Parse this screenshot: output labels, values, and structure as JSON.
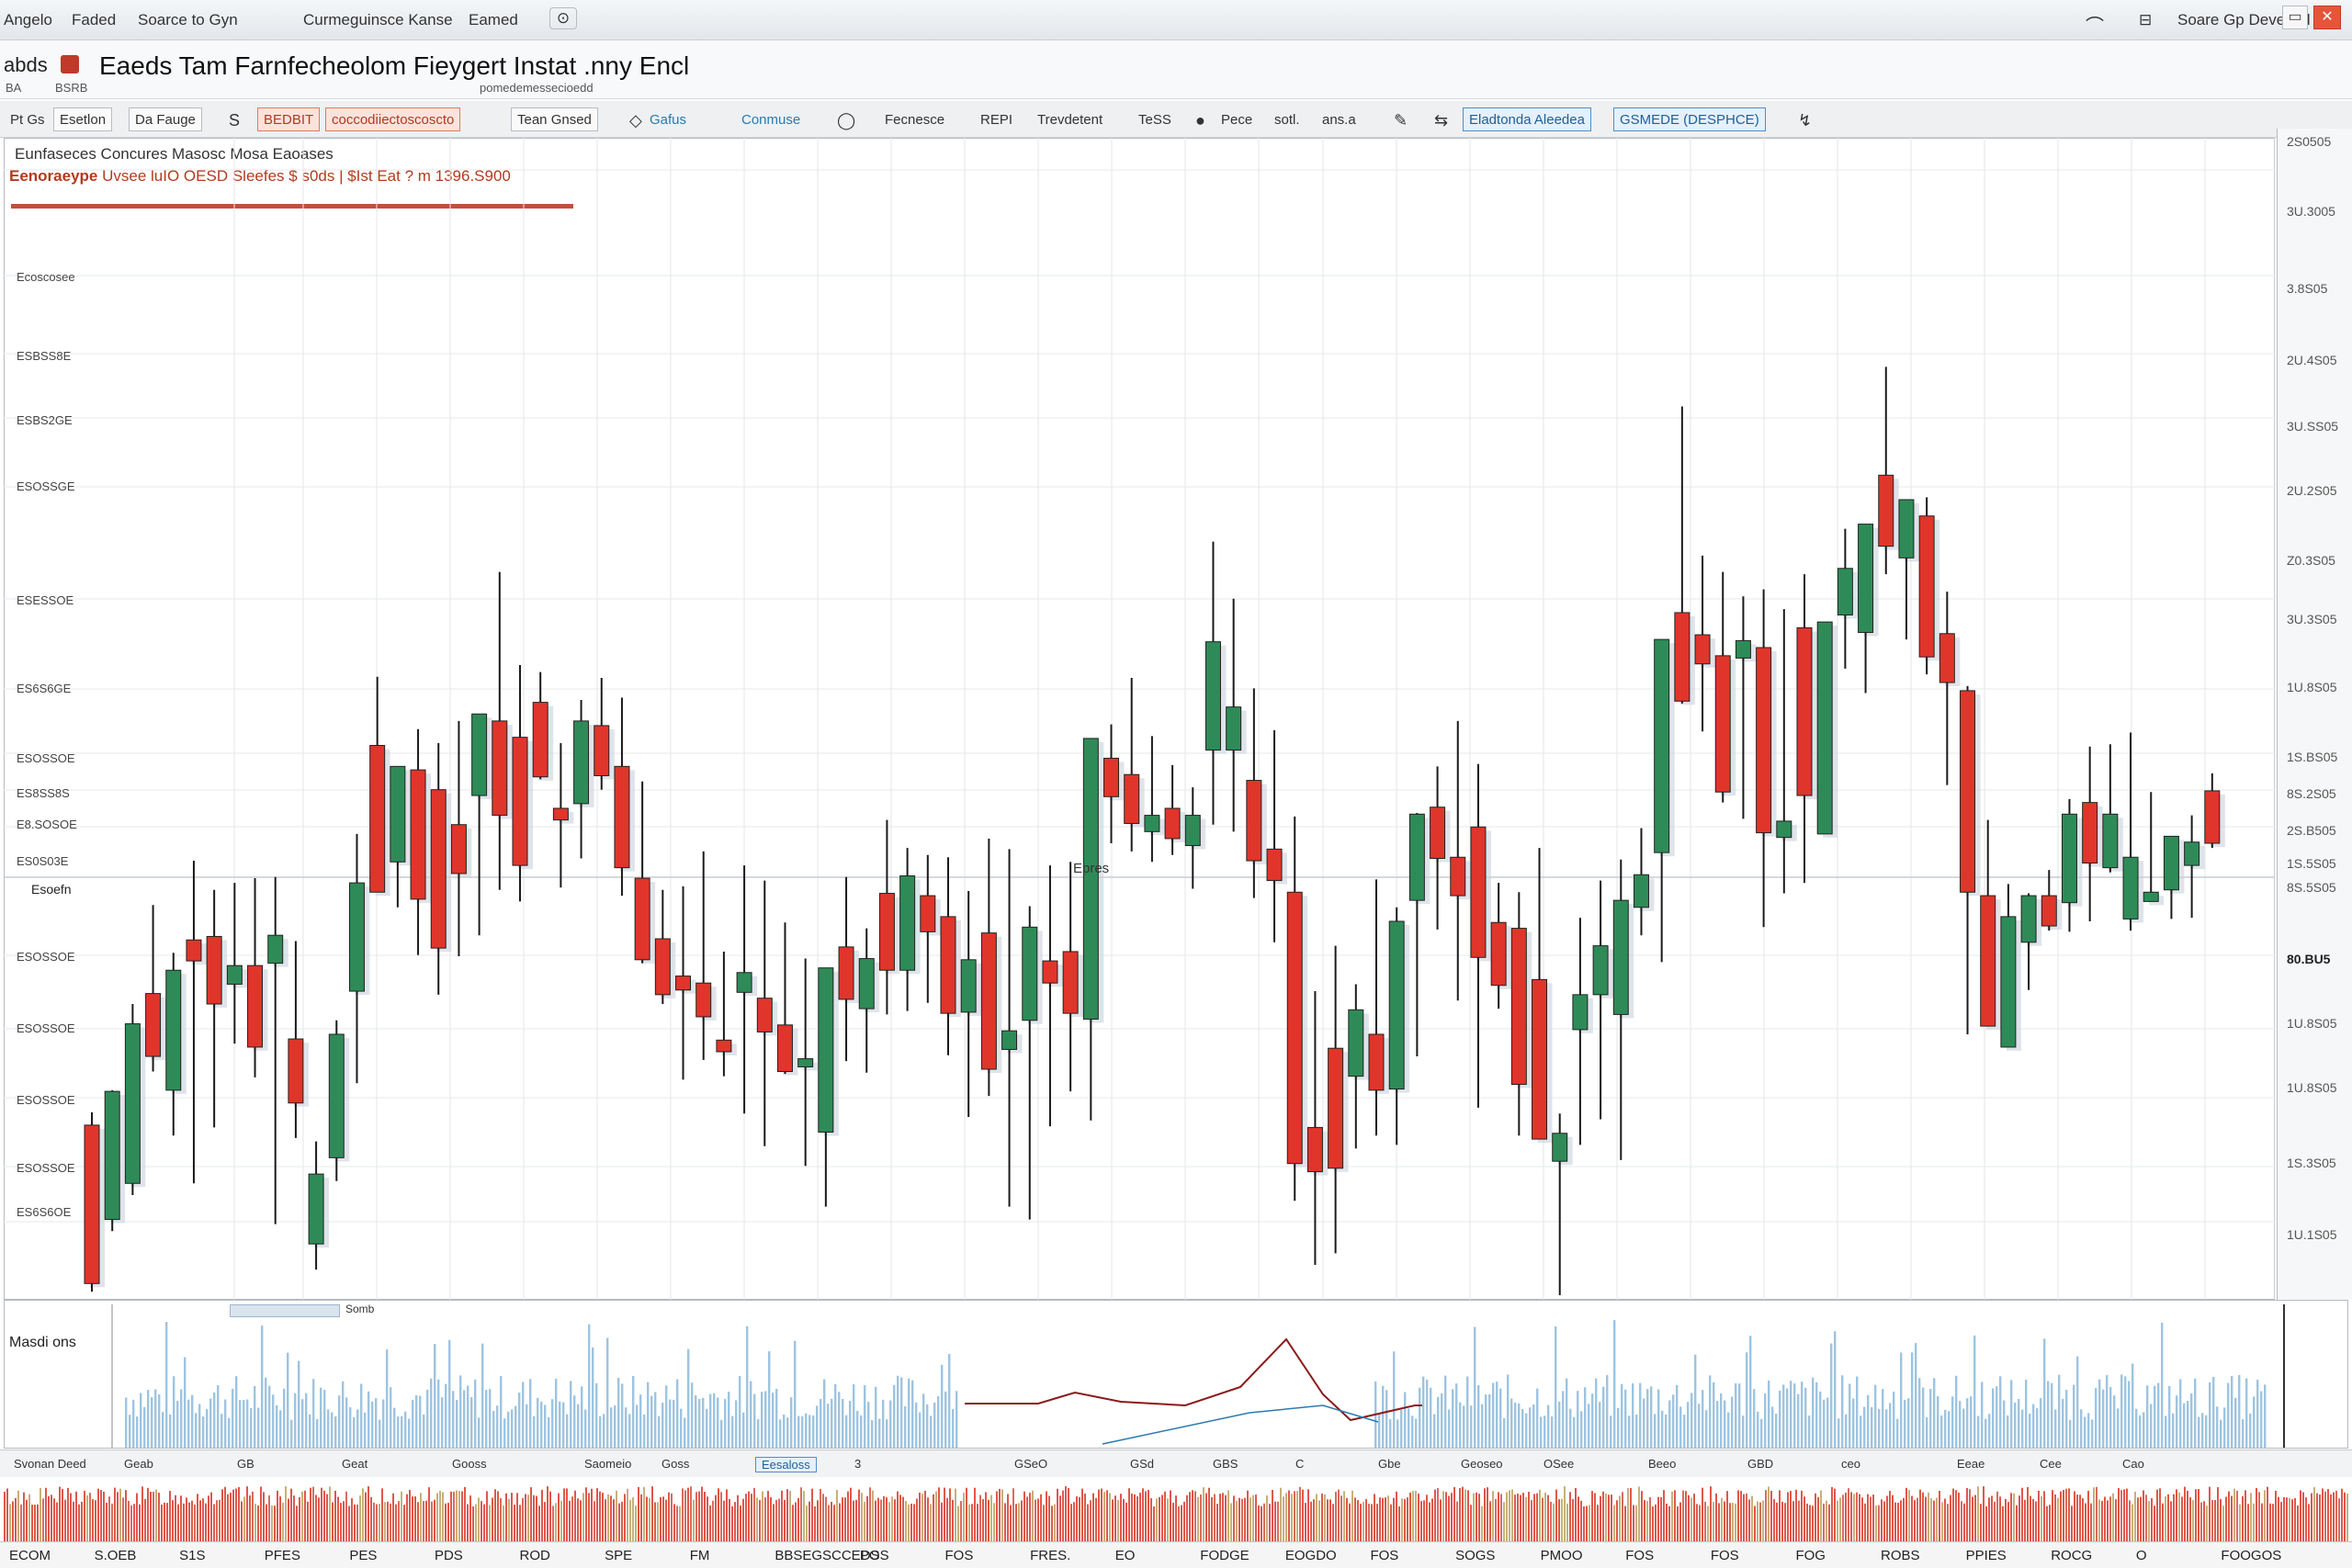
{
  "window": {
    "title_items": [
      "Angelo",
      "Faded",
      "Soarce to Gyn",
      "Curmeguinsce Kanse",
      "Eamed"
    ],
    "right_text": "Soare Gp Deveced",
    "buttons": [
      "▭",
      "—",
      "✕"
    ]
  },
  "menubar": {
    "app": "abds",
    "title": "Eaeds Tam Farnfecheolom Fieygert Instat .nny Encl",
    "sub_left": "BA",
    "sub_mid": "BSRB",
    "sub_right": "pomedemessecioedd"
  },
  "toolbar": {
    "items": [
      {
        "label": "Pt Gs",
        "style": ""
      },
      {
        "label": "Esetlon",
        "style": "boxed"
      },
      {
        "label": "Da Fauge",
        "style": "boxed"
      },
      {
        "label": "S",
        "style": "icon"
      },
      {
        "label": "BEDBIT",
        "style": "red"
      },
      {
        "label": "coccodiiectoscoscto",
        "style": "red"
      },
      {
        "label": "Tean Gnsed",
        "style": "boxed"
      },
      {
        "label": "Gafus",
        "style": "blue"
      },
      {
        "label": "Conmuse",
        "style": "blue"
      },
      {
        "label": "Fecnesce",
        "style": ""
      },
      {
        "label": "REPI",
        "style": ""
      },
      {
        "label": "Trevdetent",
        "style": ""
      },
      {
        "label": "TeSS",
        "style": ""
      },
      {
        "label": "Pece",
        "style": ""
      },
      {
        "label": "sotl.",
        "style": ""
      },
      {
        "label": "ans.a",
        "style": ""
      },
      {
        "label": "Eladtonda Aleedea",
        "style": "bluebox"
      },
      {
        "label": "GSMEDE (DESPHCE)",
        "style": "bluebox"
      }
    ]
  },
  "info": {
    "line1": "Eunfaseces Concures   Masosc Mosa Eaoases",
    "line2_prefix": "Eenoraeype",
    "line2_rest": "Uvsee luIO OESD Sleefes  $ s0ds  |  $Ist Eat ?  m  1396.S900"
  },
  "chart_data": {
    "type": "candlestick",
    "colors": {
      "up": "#2e8b57",
      "down": "#e0352b",
      "accent": "#c0392b"
    },
    "price_range": [
      0,
      100
    ],
    "grid": true,
    "candles": [
      {
        "o": 14.6,
        "h": 15.7,
        "l": 0.3,
        "c": 1.0
      },
      {
        "o": 6.5,
        "h": 17.6,
        "l": 5.5,
        "c": 17.5
      },
      {
        "o": 9.6,
        "h": 25.0,
        "l": 8.6,
        "c": 23.3
      },
      {
        "o": 25.9,
        "h": 33.5,
        "l": 19.2,
        "c": 20.5
      },
      {
        "o": 17.6,
        "h": 29.4,
        "l": 13.7,
        "c": 27.9
      },
      {
        "o": 30.5,
        "h": 37.3,
        "l": 9.6,
        "c": 28.7
      },
      {
        "o": 30.8,
        "h": 34.8,
        "l": 14.4,
        "c": 25.0
      },
      {
        "o": 26.7,
        "h": 35.4,
        "l": 21.6,
        "c": 28.3
      },
      {
        "o": 28.3,
        "h": 35.8,
        "l": 18.7,
        "c": 21.3
      },
      {
        "o": 28.5,
        "h": 35.9,
        "l": 6.1,
        "c": 30.9
      },
      {
        "o": 22.0,
        "h": 30.4,
        "l": 13.5,
        "c": 16.5
      },
      {
        "o": 4.4,
        "h": 13.2,
        "l": 2.2,
        "c": 10.4
      },
      {
        "o": 11.8,
        "h": 23.6,
        "l": 9.8,
        "c": 22.4
      },
      {
        "o": 26.1,
        "h": 39.6,
        "l": 18.2,
        "c": 35.4
      },
      {
        "o": 47.2,
        "h": 53.1,
        "l": 35.6,
        "c": 34.6
      },
      {
        "o": 37.2,
        "h": 43.9,
        "l": 33.3,
        "c": 45.4
      },
      {
        "o": 45.1,
        "h": 48.6,
        "l": 29.2,
        "c": 34.0
      },
      {
        "o": 43.4,
        "h": 47.4,
        "l": 25.8,
        "c": 29.8
      },
      {
        "o": 40.4,
        "h": 49.3,
        "l": 29.1,
        "c": 36.2
      },
      {
        "o": 42.9,
        "h": 49.3,
        "l": 30.9,
        "c": 49.9
      },
      {
        "o": 49.3,
        "h": 62.1,
        "l": 34.8,
        "c": 41.2
      },
      {
        "o": 47.9,
        "h": 54.1,
        "l": 33.8,
        "c": 36.9
      },
      {
        "o": 50.9,
        "h": 53.5,
        "l": 44.3,
        "c": 44.5
      },
      {
        "o": 41.8,
        "h": 47.4,
        "l": 35.0,
        "c": 40.8
      },
      {
        "o": 42.2,
        "h": 51.1,
        "l": 37.5,
        "c": 49.3
      },
      {
        "o": 48.9,
        "h": 53.0,
        "l": 43.4,
        "c": 44.6
      },
      {
        "o": 45.4,
        "h": 51.3,
        "l": 34.3,
        "c": 36.7
      },
      {
        "o": 35.8,
        "h": 44.1,
        "l": 28.5,
        "c": 28.8
      },
      {
        "o": 30.6,
        "h": 34.8,
        "l": 25.0,
        "c": 25.8
      },
      {
        "o": 27.4,
        "h": 35.1,
        "l": 18.5,
        "c": 26.2
      },
      {
        "o": 26.8,
        "h": 38.1,
        "l": 20.2,
        "c": 23.9
      },
      {
        "o": 21.9,
        "h": 29.5,
        "l": 18.8,
        "c": 20.9
      },
      {
        "o": 26.0,
        "h": 36.9,
        "l": 15.6,
        "c": 27.7
      },
      {
        "o": 25.5,
        "h": 35.6,
        "l": 12.8,
        "c": 22.6
      },
      {
        "o": 23.2,
        "h": 32.0,
        "l": 19.0,
        "c": 19.2
      },
      {
        "o": 19.6,
        "h": 28.9,
        "l": 11.1,
        "c": 20.3
      },
      {
        "o": 14.0,
        "h": 26.5,
        "l": 7.6,
        "c": 28.1
      },
      {
        "o": 29.9,
        "h": 35.9,
        "l": 20.1,
        "c": 25.4
      },
      {
        "o": 24.6,
        "h": 31.5,
        "l": 19.1,
        "c": 28.9
      },
      {
        "o": 34.5,
        "h": 40.8,
        "l": 24.1,
        "c": 27.9
      },
      {
        "o": 27.9,
        "h": 38.4,
        "l": 24.4,
        "c": 36.0
      },
      {
        "o": 34.3,
        "h": 37.8,
        "l": 25.1,
        "c": 31.2
      },
      {
        "o": 32.5,
        "h": 37.6,
        "l": 20.6,
        "c": 24.2
      },
      {
        "o": 24.3,
        "h": 34.7,
        "l": 15.3,
        "c": 28.8
      },
      {
        "o": 31.1,
        "h": 39.2,
        "l": 17.1,
        "c": 19.4
      },
      {
        "o": 21.1,
        "h": 38.3,
        "l": 7.6,
        "c": 22.7
      },
      {
        "o": 23.6,
        "h": 33.4,
        "l": 6.5,
        "c": 31.6
      },
      {
        "o": 28.7,
        "h": 36.9,
        "l": 14.5,
        "c": 26.8
      },
      {
        "o": 29.5,
        "h": 37.2,
        "l": 17.5,
        "c": 24.2
      },
      {
        "o": 23.7,
        "h": 38.9,
        "l": 15.0,
        "c": 47.8
      },
      {
        "o": 46.1,
        "h": 49.0,
        "l": 38.8,
        "c": 42.8
      },
      {
        "o": 44.7,
        "h": 53.0,
        "l": 38.1,
        "c": 40.5
      },
      {
        "o": 39.8,
        "h": 48.0,
        "l": 37.2,
        "c": 41.2
      },
      {
        "o": 41.8,
        "h": 45.5,
        "l": 37.8,
        "c": 39.2
      },
      {
        "o": 38.6,
        "h": 43.6,
        "l": 34.9,
        "c": 41.2
      },
      {
        "o": 46.8,
        "h": 64.7,
        "l": 40.4,
        "c": 56.1
      },
      {
        "o": 46.8,
        "h": 59.8,
        "l": 39.8,
        "c": 50.5
      },
      {
        "o": 44.2,
        "h": 52.1,
        "l": 34.1,
        "c": 37.3
      },
      {
        "o": 38.3,
        "h": 48.5,
        "l": 30.3,
        "c": 35.6
      },
      {
        "o": 34.6,
        "h": 41.1,
        "l": 8.1,
        "c": 11.3
      },
      {
        "o": 14.4,
        "h": 26.1,
        "l": 2.6,
        "c": 10.6
      },
      {
        "o": 21.2,
        "h": 30.0,
        "l": 3.6,
        "c": 10.9
      },
      {
        "o": 18.8,
        "h": 26.7,
        "l": 12.6,
        "c": 24.5
      },
      {
        "o": 22.4,
        "h": 35.7,
        "l": 13.7,
        "c": 17.6
      },
      {
        "o": 17.7,
        "h": 33.3,
        "l": 12.9,
        "c": 32.1
      },
      {
        "o": 33.9,
        "h": 41.4,
        "l": 20.5,
        "c": 41.3
      },
      {
        "o": 41.9,
        "h": 45.4,
        "l": 31.4,
        "c": 37.5
      },
      {
        "o": 37.6,
        "h": 49.3,
        "l": 25.3,
        "c": 34.3
      },
      {
        "o": 40.2,
        "h": 45.6,
        "l": 16.1,
        "c": 29.0
      },
      {
        "o": 32.0,
        "h": 35.4,
        "l": 24.6,
        "c": 26.6
      },
      {
        "o": 31.5,
        "h": 34.6,
        "l": 13.7,
        "c": 18.1
      },
      {
        "o": 27.1,
        "h": 38.4,
        "l": 17.2,
        "c": 13.4
      },
      {
        "o": 11.5,
        "h": 15.6,
        "l": 0.0,
        "c": 13.9
      },
      {
        "o": 22.8,
        "h": 32.4,
        "l": 12.9,
        "c": 25.8
      },
      {
        "o": 25.8,
        "h": 35.6,
        "l": 15.1,
        "c": 30.0
      },
      {
        "o": 24.1,
        "h": 37.4,
        "l": 11.6,
        "c": 33.9
      },
      {
        "o": 33.3,
        "h": 40.1,
        "l": 30.9,
        "c": 36.1
      },
      {
        "o": 38.0,
        "h": 51.5,
        "l": 28.6,
        "c": 56.3
      },
      {
        "o": 58.6,
        "h": 76.3,
        "l": 50.8,
        "c": 51.0
      },
      {
        "o": 56.7,
        "h": 63.5,
        "l": 48.4,
        "c": 54.2
      },
      {
        "o": 54.9,
        "h": 62.1,
        "l": 42.3,
        "c": 43.2
      },
      {
        "o": 54.7,
        "h": 60.0,
        "l": 40.9,
        "c": 56.2
      },
      {
        "o": 55.6,
        "h": 60.6,
        "l": 31.6,
        "c": 39.7
      },
      {
        "o": 39.3,
        "h": 58.9,
        "l": 34.5,
        "c": 40.7
      },
      {
        "o": 57.3,
        "h": 61.9,
        "l": 35.4,
        "c": 42.9
      },
      {
        "o": 39.6,
        "h": 57.6,
        "l": 42.2,
        "c": 57.8
      },
      {
        "o": 58.4,
        "h": 65.8,
        "l": 53.8,
        "c": 62.4
      },
      {
        "o": 56.9,
        "h": 64.0,
        "l": 51.7,
        "c": 66.2
      },
      {
        "o": 70.4,
        "h": 79.7,
        "l": 61.9,
        "c": 64.3
      },
      {
        "o": 63.3,
        "h": 67.4,
        "l": 56.3,
        "c": 68.3
      },
      {
        "o": 66.9,
        "h": 68.5,
        "l": 53.3,
        "c": 54.8
      },
      {
        "o": 56.8,
        "h": 60.4,
        "l": 43.8,
        "c": 52.6
      },
      {
        "o": 51.9,
        "h": 52.3,
        "l": 22.4,
        "c": 34.6
      },
      {
        "o": 34.3,
        "h": 40.8,
        "l": 25.9,
        "c": 23.1
      },
      {
        "o": 21.3,
        "h": 35.3,
        "l": 22.9,
        "c": 32.5
      },
      {
        "o": 30.3,
        "h": 34.5,
        "l": 26.2,
        "c": 34.3
      },
      {
        "o": 34.3,
        "h": 36.5,
        "l": 31.3,
        "c": 31.7
      },
      {
        "o": 33.7,
        "h": 42.6,
        "l": 31.2,
        "c": 41.3
      },
      {
        "o": 42.3,
        "h": 47.1,
        "l": 32.1,
        "c": 37.1
      },
      {
        "o": 36.7,
        "h": 47.3,
        "l": 36.3,
        "c": 41.3
      },
      {
        "o": 32.3,
        "h": 48.3,
        "l": 31.3,
        "c": 37.6
      },
      {
        "o": 33.8,
        "h": 43.2,
        "l": 34.1,
        "c": 34.6
      },
      {
        "o": 34.8,
        "h": 36.9,
        "l": 32.3,
        "c": 39.4
      },
      {
        "o": 36.9,
        "h": 41.2,
        "l": 32.4,
        "c": 38.9
      },
      {
        "o": 43.3,
        "h": 44.8,
        "l": 38.4,
        "c": 38.8
      }
    ],
    "axis_labels": [
      "2S0505",
      "3U.3005",
      "3.8S05",
      "2U.4S05",
      "3U.SS05",
      "2U.2S05",
      "Z0.3S05",
      "3U.3S05",
      "1U.8S05",
      "1S.BS05",
      "8S.2S05",
      "2S.B505",
      "1S.5S05",
      "8S.5S05",
      "80.BU5",
      "1U.8S05",
      "1U.8S05",
      "1S.3S05",
      "1U.1S05",
      "1U.8S05"
    ],
    "left_labels": [
      "Ecoscosee",
      "ESBSS8E",
      "ESBS2GE",
      "ESOSSGE",
      "ESESSOE",
      "ES6S6GE",
      "ESOSSOE",
      "ES8SS8S",
      "E8.SOSOE",
      "ES0S03E",
      "Esoefn",
      "ESOSSOE",
      "ESOSSOE",
      "ESOSSOE",
      "ESOSSOE",
      "ES6S6OE",
      "ESOSSOE"
    ],
    "annotation": "Epres",
    "current_price": "80.BU5"
  },
  "volume": {
    "label": "Masdi  ons",
    "header": "Somb",
    "colors": {
      "bar": "#9ec4e0",
      "line": "#8b1a1a",
      "line2": "#2a7ab0"
    }
  },
  "bottom_strip": {
    "items": [
      "Svonan Deed",
      "Geab",
      "GB",
      "Geat",
      "Gooss",
      "Saomeio",
      "Goss",
      "Eesaloss",
      "3",
      "GSeO",
      "GSd",
      "GBS",
      "C",
      "Gbe",
      "Geoseo",
      "OSee",
      "Beeo",
      "GBD",
      "ceo",
      "Eeae",
      "Cee",
      "Cao"
    ]
  },
  "footer": {
    "items": [
      "ECOM",
      "S.OEB",
      "S1S",
      "PFES",
      "PES",
      "PDS",
      "ROD",
      "SPE",
      "FM",
      "BBSEGSCCEDS",
      "POS",
      "FOS",
      "FRES.",
      "EO",
      "FODGE",
      "EOGDO",
      "FOS",
      "SOGS",
      "PMOO",
      "FOS",
      "FOS",
      "FOG",
      "ROBS",
      "PPIES",
      "ROCG",
      "O",
      "FOOGOS"
    ]
  }
}
